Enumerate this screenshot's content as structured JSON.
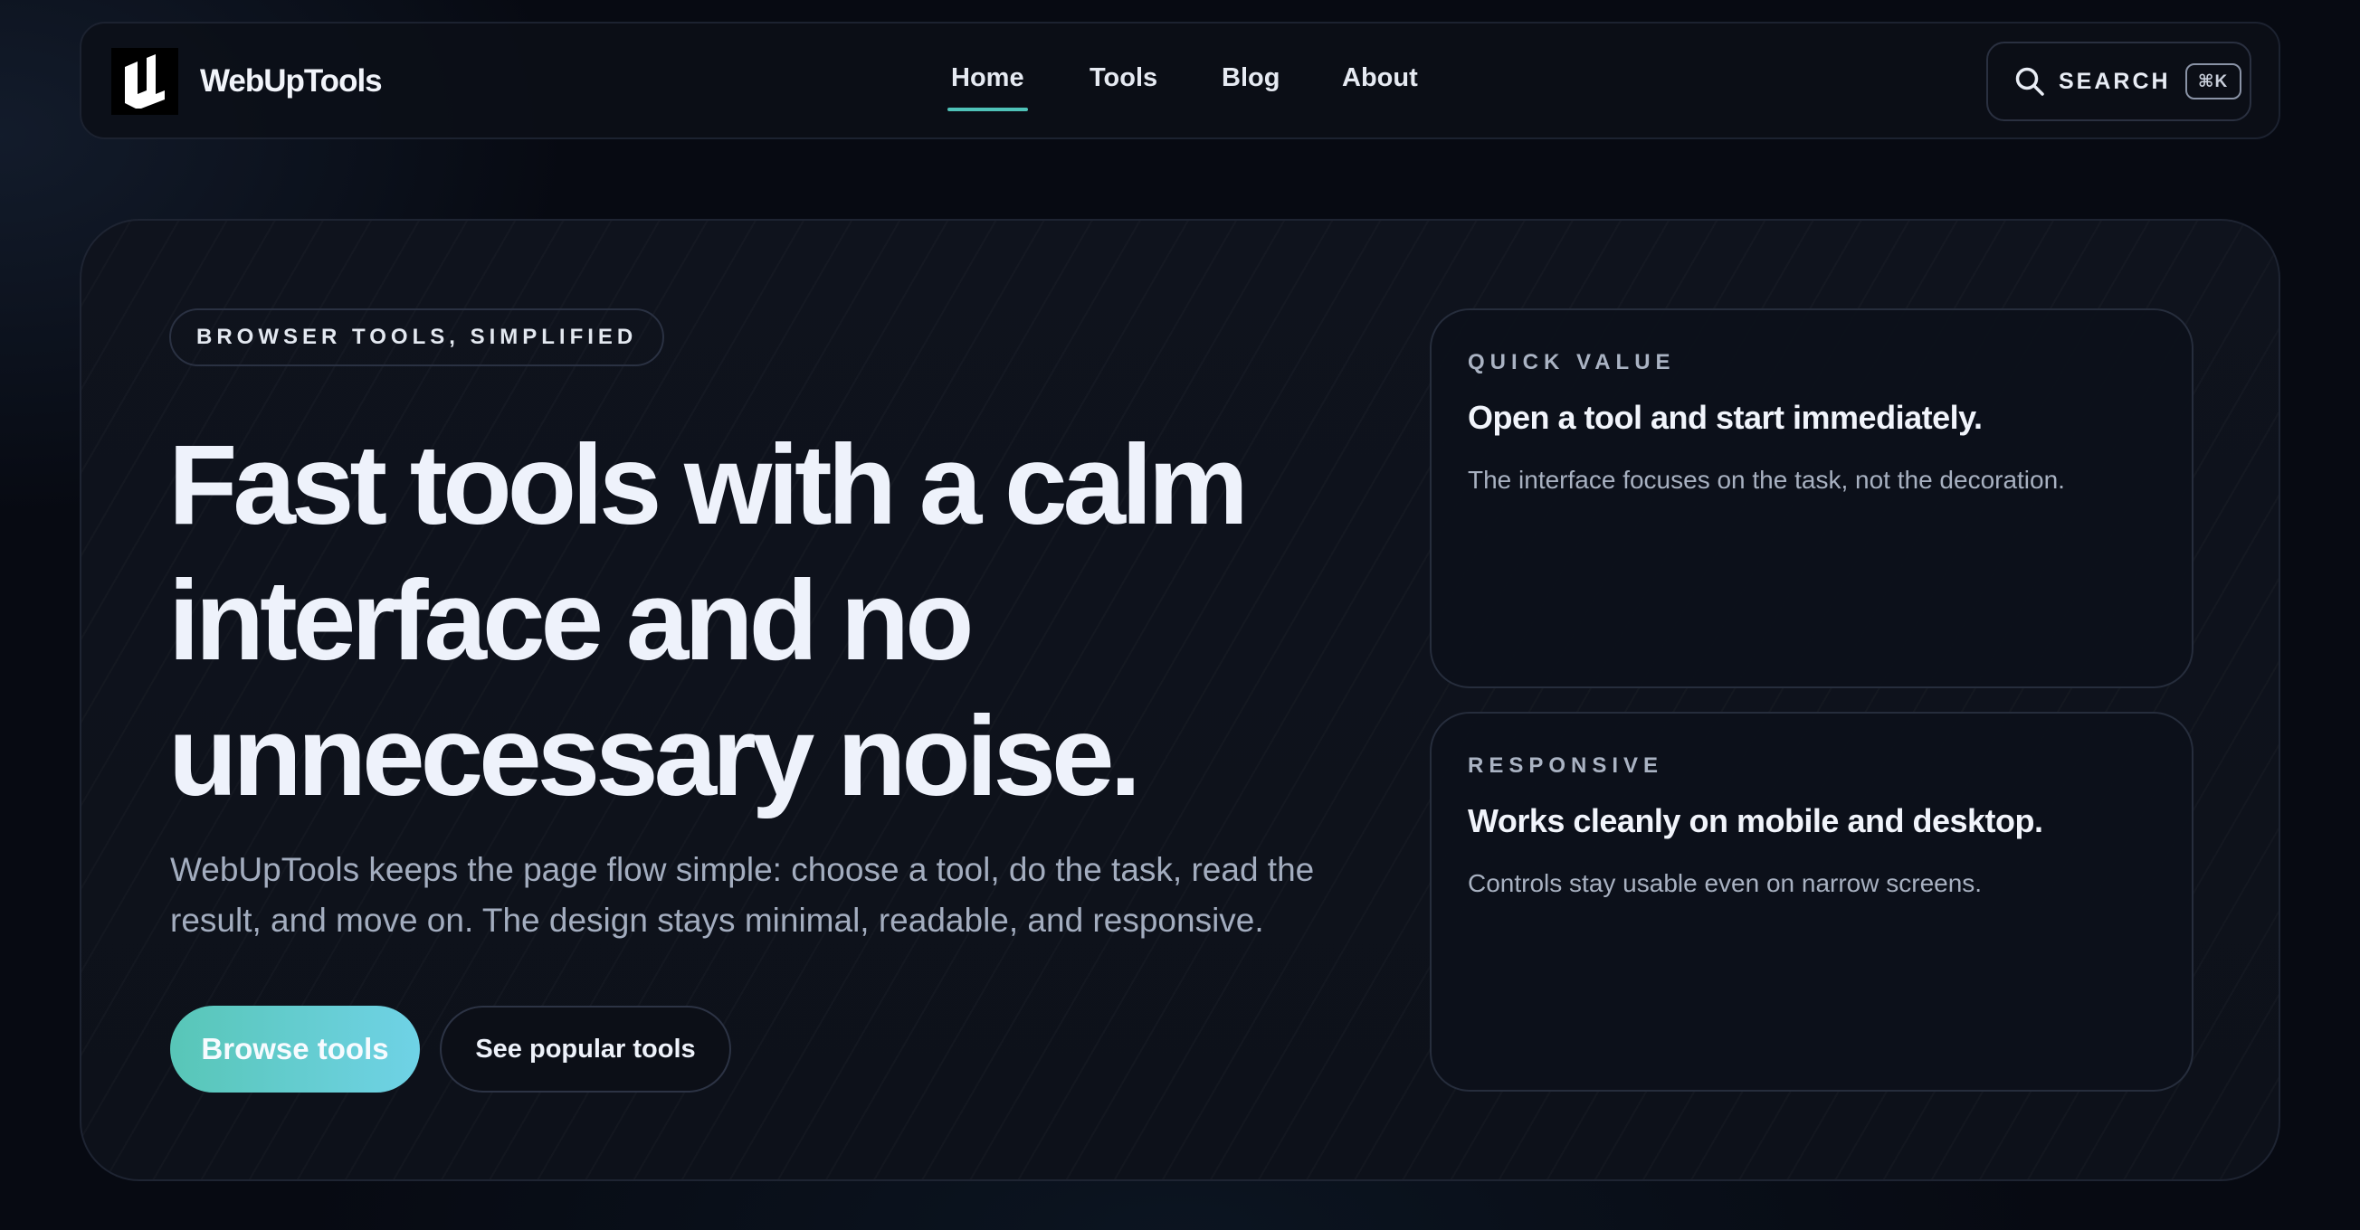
{
  "brand": {
    "name": "WebUpTools",
    "logo_icon": "wu-logo-icon"
  },
  "nav": {
    "items": [
      {
        "label": "Home",
        "active": true
      },
      {
        "label": "Tools",
        "active": false
      },
      {
        "label": "Blog",
        "active": false
      },
      {
        "label": "About",
        "active": false
      }
    ],
    "search_label": "SEARCH",
    "search_shortcut": "⌘K",
    "search_icon": "search-icon"
  },
  "hero": {
    "eyebrow": "BROWSER TOOLS, SIMPLIFIED",
    "headline_lines": [
      "Fast tools with a calm",
      "interface and no",
      "unnecessary noise."
    ],
    "subtext_lines": [
      "WebUpTools keeps the page flow simple: choose a tool, do the task, read the",
      "result, and move on. The design stays minimal, readable, and responsive."
    ],
    "primary_cta": "Browse tools",
    "secondary_cta": "See popular tools"
  },
  "cards": [
    {
      "eyebrow": "QUICK VALUE",
      "title": "Open a tool and start immediately.",
      "text": "The interface focuses on the task, not the decoration."
    },
    {
      "eyebrow": "RESPONSIVE",
      "title": "Works cleanly on mobile and desktop.",
      "text": "Controls stay usable even on narrow screens."
    }
  ],
  "colors": {
    "background": "#070a12",
    "accent": "#4fc2b8",
    "primary_gradient_start": "#58c6b7",
    "primary_gradient_end": "#6fd2e6",
    "text_primary": "#eef2fb",
    "text_muted": "#a3adbf"
  }
}
